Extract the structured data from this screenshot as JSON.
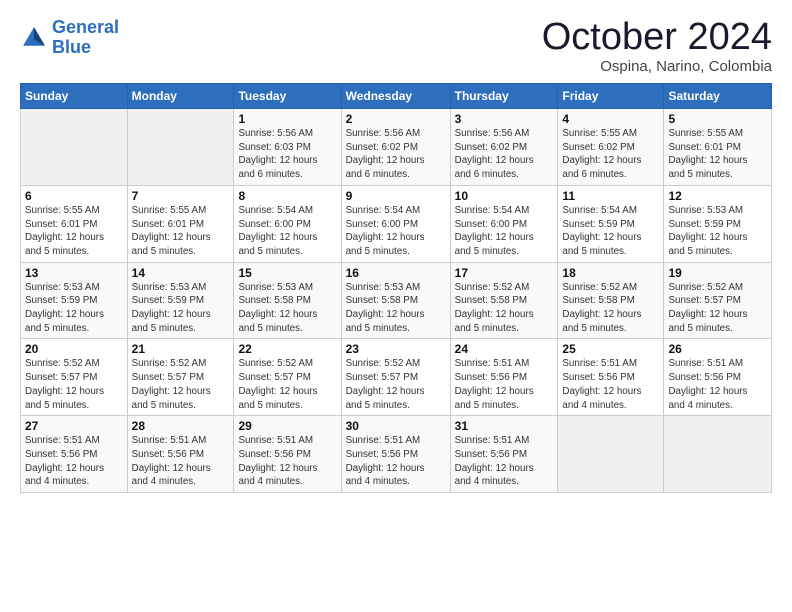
{
  "logo": {
    "line1": "General",
    "line2": "Blue"
  },
  "title": "October 2024",
  "location": "Ospina, Narino, Colombia",
  "days_header": [
    "Sunday",
    "Monday",
    "Tuesday",
    "Wednesday",
    "Thursday",
    "Friday",
    "Saturday"
  ],
  "weeks": [
    [
      {
        "day": "",
        "detail": ""
      },
      {
        "day": "",
        "detail": ""
      },
      {
        "day": "1",
        "detail": "Sunrise: 5:56 AM\nSunset: 6:03 PM\nDaylight: 12 hours\nand 6 minutes."
      },
      {
        "day": "2",
        "detail": "Sunrise: 5:56 AM\nSunset: 6:02 PM\nDaylight: 12 hours\nand 6 minutes."
      },
      {
        "day": "3",
        "detail": "Sunrise: 5:56 AM\nSunset: 6:02 PM\nDaylight: 12 hours\nand 6 minutes."
      },
      {
        "day": "4",
        "detail": "Sunrise: 5:55 AM\nSunset: 6:02 PM\nDaylight: 12 hours\nand 6 minutes."
      },
      {
        "day": "5",
        "detail": "Sunrise: 5:55 AM\nSunset: 6:01 PM\nDaylight: 12 hours\nand 5 minutes."
      }
    ],
    [
      {
        "day": "6",
        "detail": "Sunrise: 5:55 AM\nSunset: 6:01 PM\nDaylight: 12 hours\nand 5 minutes."
      },
      {
        "day": "7",
        "detail": "Sunrise: 5:55 AM\nSunset: 6:01 PM\nDaylight: 12 hours\nand 5 minutes."
      },
      {
        "day": "8",
        "detail": "Sunrise: 5:54 AM\nSunset: 6:00 PM\nDaylight: 12 hours\nand 5 minutes."
      },
      {
        "day": "9",
        "detail": "Sunrise: 5:54 AM\nSunset: 6:00 PM\nDaylight: 12 hours\nand 5 minutes."
      },
      {
        "day": "10",
        "detail": "Sunrise: 5:54 AM\nSunset: 6:00 PM\nDaylight: 12 hours\nand 5 minutes."
      },
      {
        "day": "11",
        "detail": "Sunrise: 5:54 AM\nSunset: 5:59 PM\nDaylight: 12 hours\nand 5 minutes."
      },
      {
        "day": "12",
        "detail": "Sunrise: 5:53 AM\nSunset: 5:59 PM\nDaylight: 12 hours\nand 5 minutes."
      }
    ],
    [
      {
        "day": "13",
        "detail": "Sunrise: 5:53 AM\nSunset: 5:59 PM\nDaylight: 12 hours\nand 5 minutes."
      },
      {
        "day": "14",
        "detail": "Sunrise: 5:53 AM\nSunset: 5:59 PM\nDaylight: 12 hours\nand 5 minutes."
      },
      {
        "day": "15",
        "detail": "Sunrise: 5:53 AM\nSunset: 5:58 PM\nDaylight: 12 hours\nand 5 minutes."
      },
      {
        "day": "16",
        "detail": "Sunrise: 5:53 AM\nSunset: 5:58 PM\nDaylight: 12 hours\nand 5 minutes."
      },
      {
        "day": "17",
        "detail": "Sunrise: 5:52 AM\nSunset: 5:58 PM\nDaylight: 12 hours\nand 5 minutes."
      },
      {
        "day": "18",
        "detail": "Sunrise: 5:52 AM\nSunset: 5:58 PM\nDaylight: 12 hours\nand 5 minutes."
      },
      {
        "day": "19",
        "detail": "Sunrise: 5:52 AM\nSunset: 5:57 PM\nDaylight: 12 hours\nand 5 minutes."
      }
    ],
    [
      {
        "day": "20",
        "detail": "Sunrise: 5:52 AM\nSunset: 5:57 PM\nDaylight: 12 hours\nand 5 minutes."
      },
      {
        "day": "21",
        "detail": "Sunrise: 5:52 AM\nSunset: 5:57 PM\nDaylight: 12 hours\nand 5 minutes."
      },
      {
        "day": "22",
        "detail": "Sunrise: 5:52 AM\nSunset: 5:57 PM\nDaylight: 12 hours\nand 5 minutes."
      },
      {
        "day": "23",
        "detail": "Sunrise: 5:52 AM\nSunset: 5:57 PM\nDaylight: 12 hours\nand 5 minutes."
      },
      {
        "day": "24",
        "detail": "Sunrise: 5:51 AM\nSunset: 5:56 PM\nDaylight: 12 hours\nand 5 minutes."
      },
      {
        "day": "25",
        "detail": "Sunrise: 5:51 AM\nSunset: 5:56 PM\nDaylight: 12 hours\nand 4 minutes."
      },
      {
        "day": "26",
        "detail": "Sunrise: 5:51 AM\nSunset: 5:56 PM\nDaylight: 12 hours\nand 4 minutes."
      }
    ],
    [
      {
        "day": "27",
        "detail": "Sunrise: 5:51 AM\nSunset: 5:56 PM\nDaylight: 12 hours\nand 4 minutes."
      },
      {
        "day": "28",
        "detail": "Sunrise: 5:51 AM\nSunset: 5:56 PM\nDaylight: 12 hours\nand 4 minutes."
      },
      {
        "day": "29",
        "detail": "Sunrise: 5:51 AM\nSunset: 5:56 PM\nDaylight: 12 hours\nand 4 minutes."
      },
      {
        "day": "30",
        "detail": "Sunrise: 5:51 AM\nSunset: 5:56 PM\nDaylight: 12 hours\nand 4 minutes."
      },
      {
        "day": "31",
        "detail": "Sunrise: 5:51 AM\nSunset: 5:56 PM\nDaylight: 12 hours\nand 4 minutes."
      },
      {
        "day": "",
        "detail": ""
      },
      {
        "day": "",
        "detail": ""
      }
    ]
  ]
}
